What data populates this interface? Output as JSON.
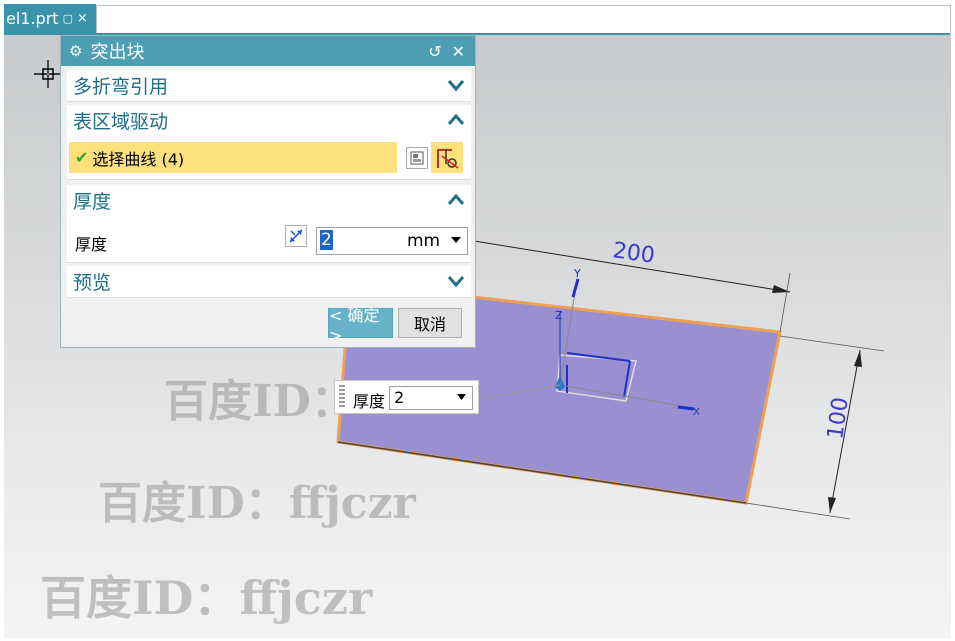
{
  "tab": {
    "title": "el1.prt",
    "pin_icon": "pin-icon",
    "close_symbol": "×"
  },
  "dialog": {
    "title": "突出块",
    "reset_symbol": "↺",
    "close_symbol": "✕",
    "sections": {
      "multi_bend": {
        "label": "多折弯引用",
        "expanded": false
      },
      "surface": {
        "label": "表区域驱动",
        "expanded": true
      },
      "thickness": {
        "label": "厚度",
        "expanded": true
      },
      "preview": {
        "label": "预览",
        "expanded": false
      }
    },
    "select_curve": {
      "check": "✔",
      "label": "选择曲线 (4)"
    },
    "thickness_field": {
      "label": "厚度",
      "value": "2",
      "unit": "mm"
    },
    "ok_label": "< 确定 >",
    "cancel_label": "取消"
  },
  "onscreen_input": {
    "label": "厚度",
    "value": "2"
  },
  "dimensions": {
    "width": "200",
    "height": "100"
  },
  "axes": {
    "x": "X",
    "y": "Y",
    "z": "Z"
  },
  "watermark": {
    "text": "百度ID：ffjczr"
  },
  "colors": {
    "accent": "#4c9fb3",
    "sheet_fill": "#9a8fd0",
    "sheet_edge": "#f0a052",
    "selection": "#fce07b"
  }
}
